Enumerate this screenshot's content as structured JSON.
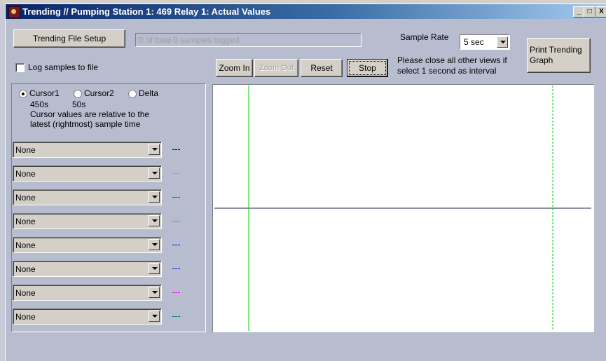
{
  "window": {
    "title": "Trending // Pumping Station 1: 469 Relay 1: Actual Values",
    "minimize_glyph": "_",
    "maximize_glyph": "□",
    "close_glyph": "X"
  },
  "toolbar": {
    "file_setup_label": "Trending File Setup",
    "samples_status": "0 of total 0 samples logged",
    "log_to_file_label": "Log samples to file",
    "log_to_file_checked": false,
    "zoom_in_label": "Zoom In",
    "zoom_out_label": "Zoom Out",
    "reset_label": "Reset",
    "stop_label": "Stop",
    "sample_rate_label": "Sample Rate",
    "sample_rate_value": "5 sec",
    "interval_note_line1": "Please close all other views if",
    "interval_note_line2": "select 1 second as interval",
    "print_label_line1": "Print Trending",
    "print_label_line2": "Graph"
  },
  "cursors": {
    "options": [
      "Cursor1",
      "Cursor2",
      "Delta"
    ],
    "selected": "Cursor1",
    "cursor1_value": "450s",
    "cursor2_value": "50s",
    "note_line1": "Cursor values are relative to the",
    "note_line2": "latest (rightmost) sample time"
  },
  "channels": [
    {
      "value": "None",
      "legend": "---",
      "color": "#000000"
    },
    {
      "value": "None",
      "legend": "---",
      "color": "#a0a0a0"
    },
    {
      "value": "None",
      "legend": "---",
      "color": "#ff0000"
    },
    {
      "value": "None",
      "legend": "---",
      "color": "#00cc00"
    },
    {
      "value": "None",
      "legend": "---",
      "color": "#0000ff"
    },
    {
      "value": "None",
      "legend": "---",
      "color": "#0000ff"
    },
    {
      "value": "None",
      "legend": "---",
      "color": "#ff00ff"
    },
    {
      "value": "None",
      "legend": "---",
      "color": "#008080"
    }
  ],
  "graph": {
    "cursor1_color": "#00cc00",
    "cursor2_color": "#00cc00",
    "axis_color": "#1a2a4a"
  }
}
